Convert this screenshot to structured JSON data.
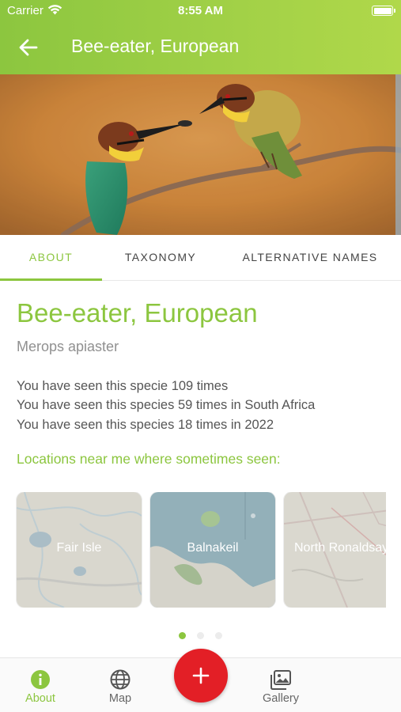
{
  "status_bar": {
    "carrier": "Carrier",
    "time": "8:55 AM"
  },
  "header": {
    "title": "Bee-eater, European",
    "back_icon": "arrow-left-icon"
  },
  "tabs": [
    {
      "label": "ABOUT",
      "active": true
    },
    {
      "label": "TAXONOMY",
      "active": false
    },
    {
      "label": "ALTERNATIVE NAMES",
      "active": false
    }
  ],
  "about": {
    "common_name": "Bee-eater, European",
    "latin_name": "Merops apiaster",
    "seen_lines": [
      "You have seen this specie 109 times",
      "You have seen this species 59 times in South Africa",
      "You have seen this species 18 times in 2022"
    ],
    "locations_title": "Locations near me where sometimes seen:",
    "locations": [
      {
        "name": "Fair Isle"
      },
      {
        "name": "Balnakeil"
      },
      {
        "name": "North Ronaldsay"
      }
    ],
    "carousel": {
      "page_count": 3,
      "active_page": 1
    }
  },
  "bottom_nav": {
    "items": [
      {
        "label": "About",
        "icon": "info-icon",
        "active": true
      },
      {
        "label": "Map",
        "icon": "globe-icon",
        "active": false
      },
      {
        "label": "Gallery",
        "icon": "gallery-icon",
        "active": false
      }
    ],
    "fab_icon": "plus-icon"
  },
  "colors": {
    "accent": "#8cc63f",
    "fab": "#e31f26"
  }
}
